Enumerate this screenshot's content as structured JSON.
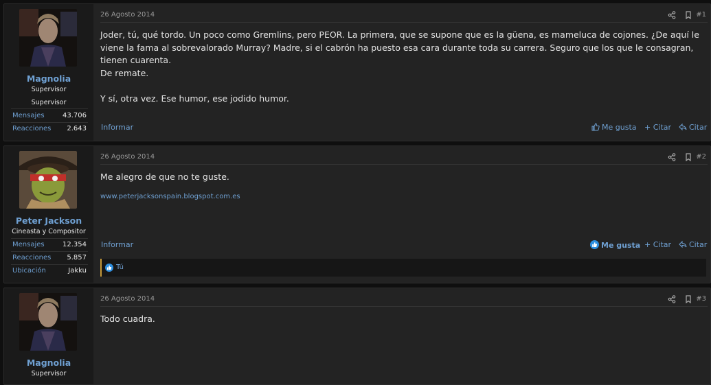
{
  "posts": [
    {
      "author": "Magnolia",
      "user_title": "Supervisor",
      "banner": "Supervisor",
      "stats": [
        {
          "label": "Mensajes",
          "value": "43.706"
        },
        {
          "label": "Reacciones",
          "value": "2.643"
        }
      ],
      "date": "26 Agosto 2014",
      "number": "#1",
      "paragraphs": [
        "Joder, tú, qué tordo. Un poco como Gremlins, pero PEOR. La primera, que se supone que es la güena, es mameluca de cojones. ¿De aquí le viene la fama al sobrevalorado Murray? Madre, si el cabrón ha puesto esa cara durante toda su carrera. Seguro que los que le consagran, tienen cuarenta.",
        "De remate.",
        "Y sí, otra vez. Ese humor, ese jodido humor."
      ],
      "report": "Informar",
      "like": "Me gusta",
      "quote": "Citar",
      "reply": "Citar"
    },
    {
      "author": "Peter Jackson",
      "user_title": "Cineasta y Compositor",
      "stats": [
        {
          "label": "Mensajes",
          "value": "12.354"
        },
        {
          "label": "Reacciones",
          "value": "5.857"
        },
        {
          "label": "Ubicación",
          "value": "Jakku"
        }
      ],
      "date": "26 Agosto 2014",
      "number": "#2",
      "paragraphs": [
        "Me alegro de que no te guste."
      ],
      "signature": "www.peterjacksonspain.blogspot.com.es",
      "report": "Informar",
      "like": "Me gusta",
      "quote": "Citar",
      "reply": "Citar",
      "liked_by": "Tú"
    },
    {
      "author": "Magnolia",
      "user_title": "Supervisor",
      "date": "26 Agosto 2014",
      "number": "#3",
      "paragraphs": [
        "Todo cuadra."
      ]
    }
  ],
  "colors": {
    "accent": "#6fa0d2",
    "background": "#0f0f0f",
    "panel": "#232323",
    "sidebar": "#1a1a1a"
  }
}
